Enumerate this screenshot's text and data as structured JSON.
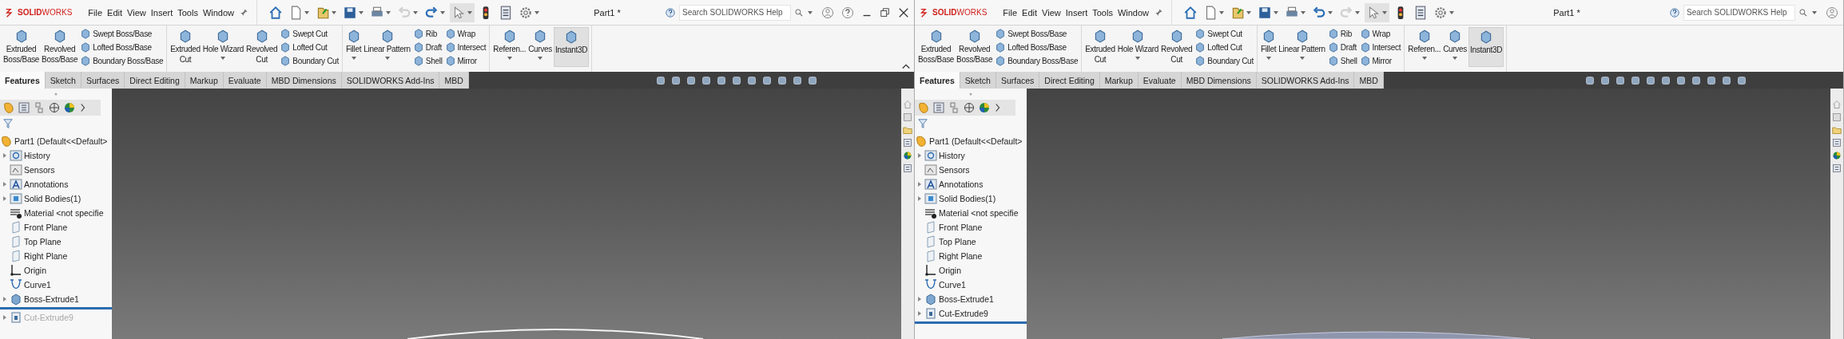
{
  "windows": [
    {
      "logo": "**SOLID**WORKS",
      "menu": [
        "File",
        "Edit",
        "View",
        "Insert",
        "Tools",
        "Window"
      ],
      "undo_enabled": false,
      "redo_enabled": true,
      "title": "Part1 *",
      "search": {
        "placeholder": "Search SOLIDWORKS Help"
      },
      "window_controls": true,
      "ribbon_collapse": true,
      "ribbon": [
        {
          "items": [
            {
              "kind": "large",
              "label": "Extruded\nBoss/Base",
              "dropdown": false,
              "pressed": false
            },
            {
              "kind": "large",
              "label": "Revolved\nBoss/Base",
              "dropdown": false,
              "pressed": false
            },
            {
              "kind": "stack",
              "items": [
                "Swept Boss/Base",
                "Lofted Boss/Base",
                "Boundary Boss/Base"
              ]
            }
          ]
        },
        {
          "items": [
            {
              "kind": "large",
              "label": "Extruded\nCut",
              "dropdown": false,
              "pressed": false
            },
            {
              "kind": "large",
              "label": "Hole Wizard",
              "dropdown": true,
              "pressed": false
            },
            {
              "kind": "large",
              "label": "Revolved\nCut",
              "dropdown": false,
              "pressed": false
            },
            {
              "kind": "stack",
              "items": [
                "Swept Cut",
                "Lofted Cut",
                "Boundary Cut"
              ]
            }
          ]
        },
        {
          "items": [
            {
              "kind": "large",
              "label": "Fillet",
              "dropdown": true,
              "pressed": false
            },
            {
              "kind": "large",
              "label": "Linear Pattern",
              "dropdown": true,
              "pressed": false
            },
            {
              "kind": "stack",
              "items": [
                "Rib",
                "Draft",
                "Shell"
              ]
            },
            {
              "kind": "stack",
              "items": [
                "Wrap",
                "Intersect",
                "Mirror"
              ]
            }
          ]
        },
        {
          "items": [
            {
              "kind": "large",
              "label": "Referen...",
              "dropdown": true,
              "pressed": false
            },
            {
              "kind": "large",
              "label": "Curves",
              "dropdown": true,
              "pressed": false
            },
            {
              "kind": "large",
              "label": "Instant3D",
              "dropdown": false,
              "pressed": true
            }
          ]
        }
      ],
      "tabs": [
        {
          "label": "Features",
          "selected": true
        },
        {
          "label": "Sketch",
          "selected": false
        },
        {
          "label": "Surfaces",
          "selected": false
        },
        {
          "label": "Direct Editing",
          "selected": false
        },
        {
          "label": "Markup",
          "selected": false
        },
        {
          "label": "Evaluate",
          "selected": false
        },
        {
          "label": "MBD Dimensions",
          "selected": false
        },
        {
          "label": "SOLIDWORKS Add-Ins",
          "selected": false
        },
        {
          "label": "MBD",
          "selected": false
        }
      ],
      "tree": {
        "label": "Part1  (Default<<Default>",
        "children": [
          {
            "kind": "folder",
            "label": "History",
            "expandable": true,
            "suppressed": false
          },
          {
            "kind": "sensor",
            "label": "Sensors",
            "expandable": false,
            "suppressed": false
          },
          {
            "kind": "annotation",
            "label": "Annotations",
            "expandable": true,
            "suppressed": false
          },
          {
            "kind": "body",
            "label": "Solid Bodies(1)",
            "expandable": true,
            "suppressed": false
          },
          {
            "kind": "material",
            "label": "Material <not specifie",
            "expandable": false,
            "suppressed": false
          },
          {
            "kind": "plane",
            "label": "Front Plane",
            "expandable": false,
            "suppressed": false
          },
          {
            "kind": "plane",
            "label": "Top Plane",
            "expandable": false,
            "suppressed": false
          },
          {
            "kind": "plane",
            "label": "Right Plane",
            "expandable": false,
            "suppressed": false
          },
          {
            "kind": "origin",
            "label": "Origin",
            "expandable": false,
            "suppressed": false
          },
          {
            "kind": "curve",
            "label": "Curve1",
            "expandable": false,
            "suppressed": false
          },
          {
            "kind": "extrude",
            "label": "Boss-Extrude1",
            "expandable": true,
            "suppressed": false
          },
          {
            "kind": "rollback"
          },
          {
            "kind": "cut",
            "label": "Cut-Extrude9",
            "expandable": true,
            "suppressed": true
          }
        ]
      },
      "model": {
        "kind": "outline"
      }
    },
    {
      "logo": "**SOLID**WORKS",
      "menu": [
        "File",
        "Edit",
        "View",
        "Insert",
        "Tools",
        "Window"
      ],
      "undo_enabled": true,
      "redo_enabled": false,
      "title": "Part1 *",
      "search": {
        "placeholder": "Search SOLIDWORKS Help"
      },
      "window_controls": false,
      "ribbon_collapse": false,
      "ribbon": [
        {
          "items": [
            {
              "kind": "large",
              "label": "Extruded\nBoss/Base",
              "dropdown": false,
              "pressed": false
            },
            {
              "kind": "large",
              "label": "Revolved\nBoss/Base",
              "dropdown": false,
              "pressed": false
            },
            {
              "kind": "stack",
              "items": [
                "Swept Boss/Base",
                "Lofted Boss/Base",
                "Boundary Boss/Base"
              ]
            }
          ]
        },
        {
          "items": [
            {
              "kind": "large",
              "label": "Extruded\nCut",
              "dropdown": false,
              "pressed": false
            },
            {
              "kind": "large",
              "label": "Hole Wizard",
              "dropdown": true,
              "pressed": false
            },
            {
              "kind": "large",
              "label": "Revolved\nCut",
              "dropdown": false,
              "pressed": false
            },
            {
              "kind": "stack",
              "items": [
                "Swept Cut",
                "Lofted Cut",
                "Boundary Cut"
              ]
            }
          ]
        },
        {
          "items": [
            {
              "kind": "large",
              "label": "Fillet",
              "dropdown": true,
              "pressed": false
            },
            {
              "kind": "large",
              "label": "Linear Pattern",
              "dropdown": true,
              "pressed": false
            },
            {
              "kind": "stack",
              "items": [
                "Rib",
                "Draft",
                "Shell"
              ]
            },
            {
              "kind": "stack",
              "items": [
                "Wrap",
                "Intersect",
                "Mirror"
              ]
            }
          ]
        },
        {
          "items": [
            {
              "kind": "large",
              "label": "Referen...",
              "dropdown": true,
              "pressed": false
            },
            {
              "kind": "large",
              "label": "Curves",
              "dropdown": true,
              "pressed": false
            },
            {
              "kind": "large",
              "label": "Instant3D",
              "dropdown": false,
              "pressed": true
            }
          ]
        }
      ],
      "tabs": [
        {
          "label": "Features",
          "selected": true
        },
        {
          "label": "Sketch",
          "selected": false
        },
        {
          "label": "Surfaces",
          "selected": false
        },
        {
          "label": "Direct Editing",
          "selected": false
        },
        {
          "label": "Markup",
          "selected": false
        },
        {
          "label": "Evaluate",
          "selected": false
        },
        {
          "label": "MBD Dimensions",
          "selected": false
        },
        {
          "label": "SOLIDWORKS Add-Ins",
          "selected": false
        },
        {
          "label": "MBD",
          "selected": false
        }
      ],
      "tree": {
        "label": "Part1  (Default<<Default>",
        "children": [
          {
            "kind": "folder",
            "label": "History",
            "expandable": true,
            "suppressed": false
          },
          {
            "kind": "sensor",
            "label": "Sensors",
            "expandable": false,
            "suppressed": false
          },
          {
            "kind": "annotation",
            "label": "Annotations",
            "expandable": true,
            "suppressed": false
          },
          {
            "kind": "body",
            "label": "Solid Bodies(1)",
            "expandable": true,
            "suppressed": false
          },
          {
            "kind": "material",
            "label": "Material <not specifie",
            "expandable": false,
            "suppressed": false
          },
          {
            "kind": "plane",
            "label": "Front Plane",
            "expandable": false,
            "suppressed": false
          },
          {
            "kind": "plane",
            "label": "Top Plane",
            "expandable": false,
            "suppressed": false
          },
          {
            "kind": "plane",
            "label": "Right Plane",
            "expandable": false,
            "suppressed": false
          },
          {
            "kind": "origin",
            "label": "Origin",
            "expandable": false,
            "suppressed": false
          },
          {
            "kind": "curve",
            "label": "Curve1",
            "expandable": false,
            "suppressed": false
          },
          {
            "kind": "extrude",
            "label": "Boss-Extrude1",
            "expandable": true,
            "suppressed": false
          },
          {
            "kind": "cut",
            "label": "Cut-Extrude9",
            "expandable": true,
            "suppressed": false
          },
          {
            "kind": "rollback"
          }
        ]
      },
      "model": {
        "kind": "shaded"
      }
    }
  ]
}
